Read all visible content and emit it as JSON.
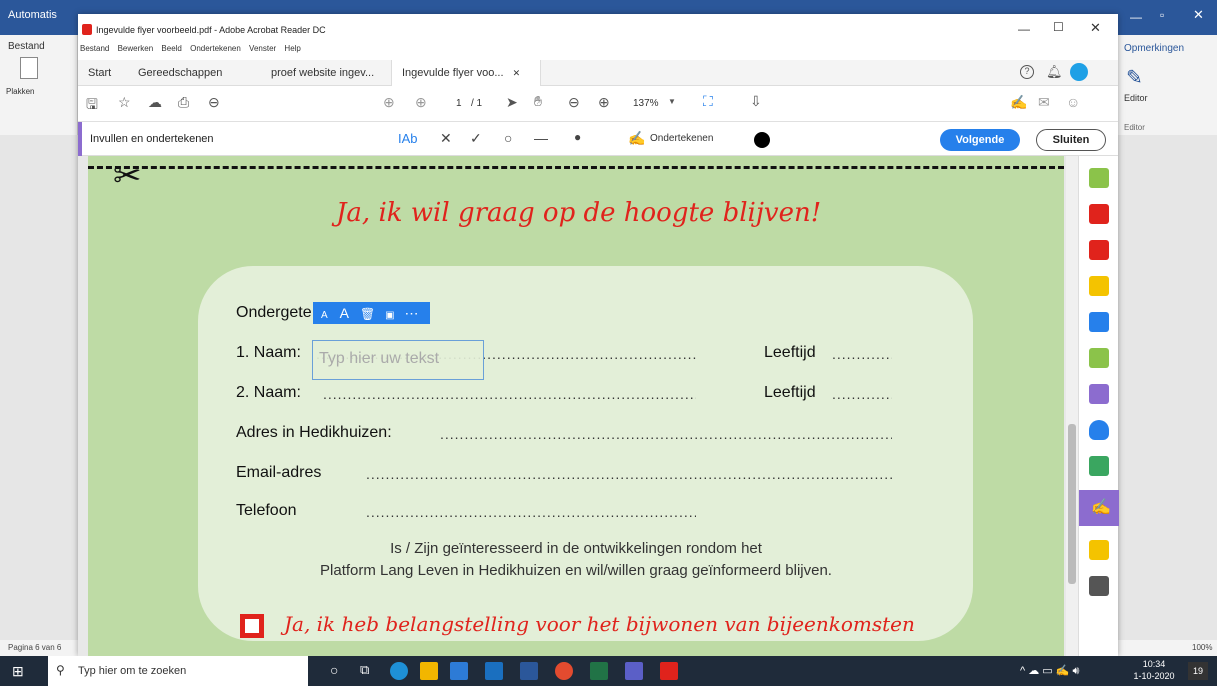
{
  "word": {
    "title": "Automatis",
    "bestand": "Bestand",
    "plakken": "Plakken",
    "opmerkingen": "Opmerkingen",
    "editor": "Editor",
    "editor_group": "Editor",
    "status_page": "Pagina 6 van 6",
    "zoom": "100%"
  },
  "acrobat": {
    "window_title": "Ingevulde flyer voorbeeld.pdf - Adobe Acrobat Reader DC",
    "menu": [
      "Bestand",
      "Bewerken",
      "Beeld",
      "Ondertekenen",
      "Venster",
      "Help"
    ],
    "tabs": [
      "Start",
      "Gereedschappen",
      "proef website ingev...",
      "Ingevulde flyer voo..."
    ],
    "page_current": "1",
    "page_total": "/ 1",
    "zoom": "137%",
    "fill_sign_title": "Invullen en ondertekenen",
    "text_tool": "IAb",
    "sign_label": "Ondertekenen",
    "next_button": "Volgende",
    "close_button": "Sluiten"
  },
  "pdf": {
    "headline": "Ja, ik wil graag op de hoogte blijven!",
    "ondergetekende": "Ondergete",
    "naam1_label": "1.  Naam:",
    "naam2_label": "2.  Naam:",
    "leeftijd": "Leeftijd",
    "adres_label": "Adres in Hedikhuizen:",
    "email_label": "Email-adres",
    "telefoon_label": "Telefoon",
    "placeholder": "Typ hier uw tekst",
    "interest_line1": "Is / Zijn geïnteresseerd in de ontwikkelingen rondom het",
    "interest_line2": "Platform Lang Leven in Hedikhuizen en wil/willen graag geïnformeerd blijven.",
    "checkbox_text": "Ja, ik heb belangstelling voor het bijwonen van bijeenkomsten"
  },
  "taskbar": {
    "search_placeholder": "Typ hier om te zoeken",
    "time": "10:34",
    "date": "1-10-2020",
    "notif_count": "19"
  },
  "colors": {
    "acrobat_purple": "#8c6ccf",
    "next_blue": "#2680eb",
    "page_green": "#bedba5",
    "red": "#e0231c"
  }
}
